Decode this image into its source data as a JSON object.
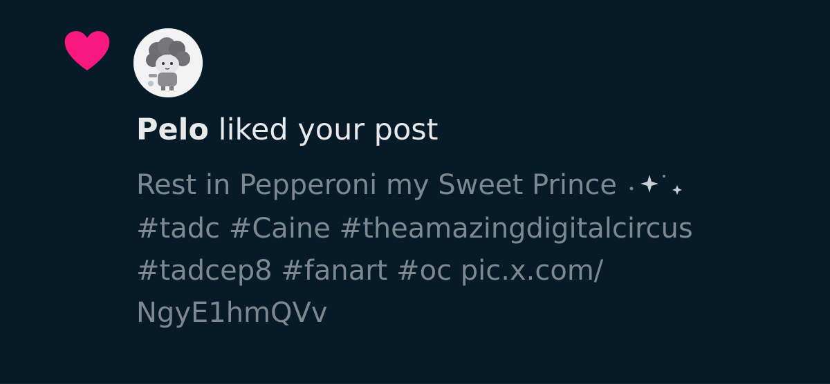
{
  "notification": {
    "type_icon": "heart-icon",
    "accent_color": "#f91880",
    "user_name": "Pelo",
    "action_text": "liked your post",
    "post": {
      "line1": "Rest in Pepperoni my Sweet Prince",
      "line1_suffix_icon": "sparkle-icon",
      "line2": "#tadc #Caine #theamazingdigitalcircus",
      "line3": "#tadcep8 #fanart #oc pic.x.com/",
      "line4": "NgyE1hmQVv"
    }
  },
  "colors": {
    "background": "#061a28",
    "primary_text": "#e7e9ea",
    "secondary_text": "#7d8891"
  }
}
